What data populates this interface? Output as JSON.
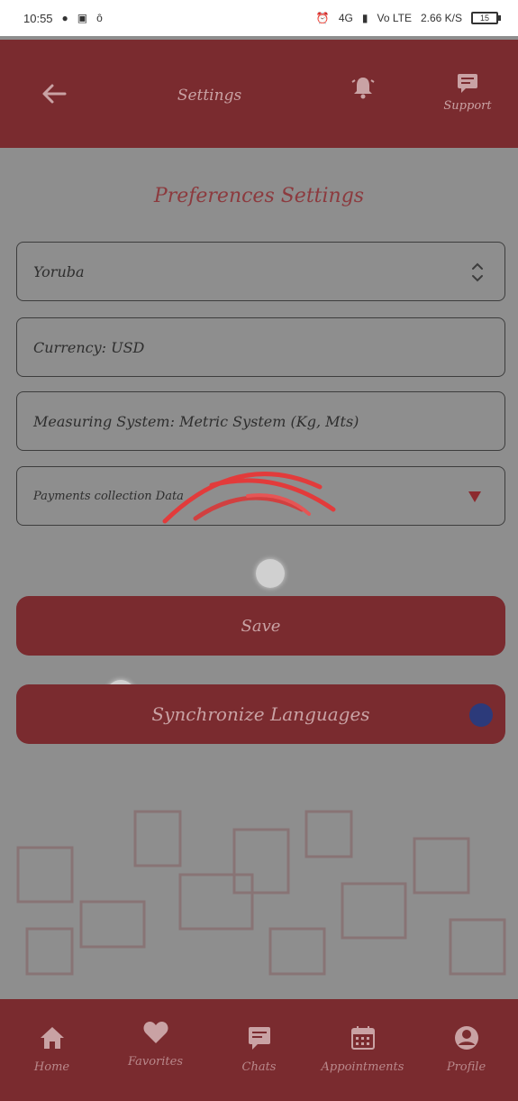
{
  "statusbar": {
    "time": "10:55",
    "network1": "4G",
    "network2": "Vo LTE",
    "speed": "2.66 K/S",
    "battery": "15"
  },
  "appbar": {
    "title": "Settings",
    "support_label": "Support"
  },
  "section_title": "Preferences Settings",
  "fields": {
    "language": "Yoruba",
    "currency": "Currency: USD",
    "measuring": "Measuring System: Metric System (Kg, Mts)",
    "payments": "Payments collection Data"
  },
  "buttons": {
    "save": "Save",
    "sync": "Synchronize Languages"
  },
  "nav": [
    {
      "label": "Home",
      "icon": "home-icon"
    },
    {
      "label": "Favorites",
      "icon": "heart-icon"
    },
    {
      "label": "Chats",
      "icon": "chat-icon"
    },
    {
      "label": "Appointments",
      "icon": "calendar-icon"
    },
    {
      "label": "Profile",
      "icon": "profile-icon"
    }
  ],
  "colors": {
    "primary": "#7a2b2f",
    "accent_text": "#c9a2a4",
    "loading_arc": "#e23b3b",
    "badge": "#2c3a7a"
  }
}
